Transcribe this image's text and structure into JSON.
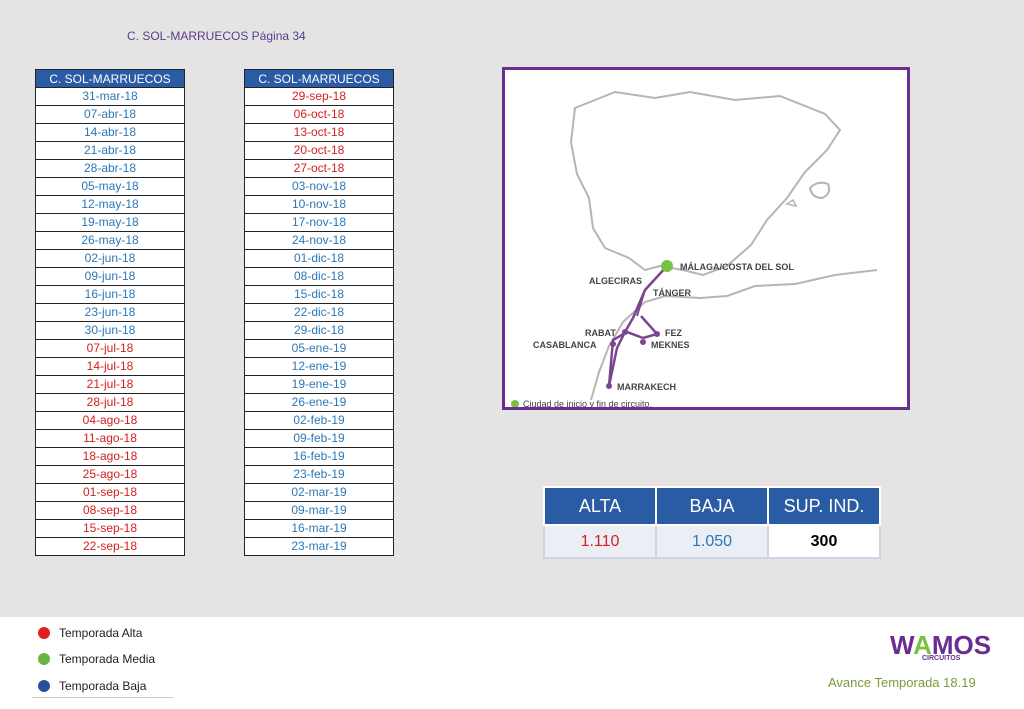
{
  "page_title": "C. SOL-MARRUECOS Página 34",
  "table_left": {
    "header": "C. SOL-MARRUECOS",
    "rows": [
      {
        "date": "31-mar-18",
        "season": "baja"
      },
      {
        "date": "07-abr-18",
        "season": "baja"
      },
      {
        "date": "14-abr-18",
        "season": "baja"
      },
      {
        "date": "21-abr-18",
        "season": "baja"
      },
      {
        "date": "28-abr-18",
        "season": "baja"
      },
      {
        "date": "05-may-18",
        "season": "baja"
      },
      {
        "date": "12-may-18",
        "season": "baja"
      },
      {
        "date": "19-may-18",
        "season": "baja"
      },
      {
        "date": "26-may-18",
        "season": "baja"
      },
      {
        "date": "02-jun-18",
        "season": "baja"
      },
      {
        "date": "09-jun-18",
        "season": "baja"
      },
      {
        "date": "16-jun-18",
        "season": "baja"
      },
      {
        "date": "23-jun-18",
        "season": "baja"
      },
      {
        "date": "30-jun-18",
        "season": "baja"
      },
      {
        "date": "07-jul-18",
        "season": "alta"
      },
      {
        "date": "14-jul-18",
        "season": "alta"
      },
      {
        "date": "21-jul-18",
        "season": "alta"
      },
      {
        "date": "28-jul-18",
        "season": "alta"
      },
      {
        "date": "04-ago-18",
        "season": "alta"
      },
      {
        "date": "11-ago-18",
        "season": "alta"
      },
      {
        "date": "18-ago-18",
        "season": "alta"
      },
      {
        "date": "25-ago-18",
        "season": "alta"
      },
      {
        "date": "01-sep-18",
        "season": "alta"
      },
      {
        "date": "08-sep-18",
        "season": "alta"
      },
      {
        "date": "15-sep-18",
        "season": "alta"
      },
      {
        "date": "22-sep-18",
        "season": "alta"
      }
    ]
  },
  "table_right": {
    "header": "C. SOL-MARRUECOS",
    "rows": [
      {
        "date": "29-sep-18",
        "season": "alta"
      },
      {
        "date": "06-oct-18",
        "season": "alta"
      },
      {
        "date": "13-oct-18",
        "season": "alta"
      },
      {
        "date": "20-oct-18",
        "season": "alta"
      },
      {
        "date": "27-oct-18",
        "season": "alta"
      },
      {
        "date": "03-nov-18",
        "season": "baja"
      },
      {
        "date": "10-nov-18",
        "season": "baja"
      },
      {
        "date": "17-nov-18",
        "season": "baja"
      },
      {
        "date": "24-nov-18",
        "season": "baja"
      },
      {
        "date": "01-dic-18",
        "season": "baja"
      },
      {
        "date": "08-dic-18",
        "season": "baja"
      },
      {
        "date": "15-dic-18",
        "season": "baja"
      },
      {
        "date": "22-dic-18",
        "season": "baja"
      },
      {
        "date": "29-dic-18",
        "season": "baja"
      },
      {
        "date": "05-ene-19",
        "season": "baja"
      },
      {
        "date": "12-ene-19",
        "season": "baja"
      },
      {
        "date": "19-ene-19",
        "season": "baja"
      },
      {
        "date": "26-ene-19",
        "season": "baja"
      },
      {
        "date": "02-feb-19",
        "season": "baja"
      },
      {
        "date": "09-feb-19",
        "season": "baja"
      },
      {
        "date": "16-feb-19",
        "season": "baja"
      },
      {
        "date": "23-feb-19",
        "season": "baja"
      },
      {
        "date": "02-mar-19",
        "season": "baja"
      },
      {
        "date": "09-mar-19",
        "season": "baja"
      },
      {
        "date": "16-mar-19",
        "season": "baja"
      },
      {
        "date": "23-mar-19",
        "season": "baja"
      }
    ]
  },
  "map": {
    "cities": {
      "malaga": "MÁLAGA/COSTA DEL SOL",
      "algeciras": "ALGECIRAS",
      "tanger": "TÁNGER",
      "rabat": "RABAT",
      "casablanca": "CASABLANCA",
      "fez": "FEZ",
      "meknes": "MEKNES",
      "marrakech": "MARRAKECH"
    },
    "legend": "Ciudad de inicio y fin de circuito."
  },
  "prices": {
    "headers": [
      "ALTA",
      "BAJA",
      "SUP. IND."
    ],
    "values": [
      "1.110",
      "1.050",
      "300"
    ]
  },
  "legend": {
    "items": [
      {
        "label": "Temporada Alta",
        "color": "#e0201c"
      },
      {
        "label": "Temporada Media",
        "color": "#6cb33f"
      },
      {
        "label": "Temporada Baja",
        "color": "#2c4f9a"
      }
    ]
  },
  "brand": {
    "logo_w": "W",
    "logo_a": "A",
    "logo_rest": "MOS",
    "logo_sub": "CIRCUITOS",
    "season": "Avance Temporada 18.19"
  },
  "colors": {
    "header_bg": "#2a5ba5",
    "alta": "#d42020",
    "baja": "#2b78b8",
    "route": "#7b4592",
    "start_dot": "#7ac143"
  }
}
